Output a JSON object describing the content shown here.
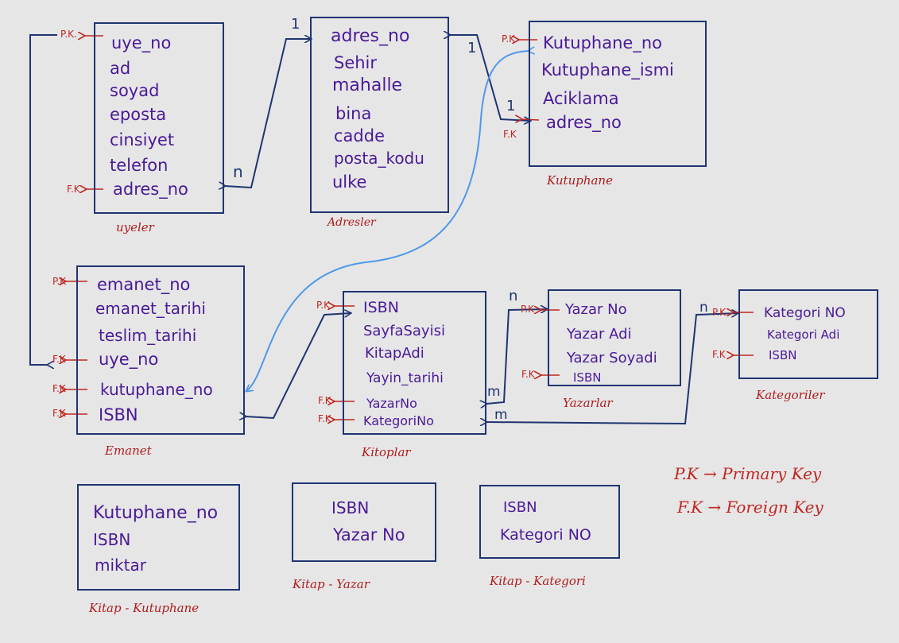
{
  "colors": {
    "background": "#e6e6e7",
    "box_border": "#1f3570",
    "field_text": "#4a1a96",
    "key_marker": "#c0261f",
    "caption": "#b01c1c",
    "blue_link": "#4f98e8"
  },
  "tables": {
    "uyeler": {
      "caption": "uyeler",
      "fields": [
        "uye_no",
        "ad",
        "soyad",
        "eposta",
        "cinsiyet",
        "telefon",
        "adres_no"
      ],
      "keys": [
        "P.K.",
        "F.K."
      ]
    },
    "adresler": {
      "caption": "Adresler",
      "fields": [
        "adres_no",
        "Sehir",
        "mahalle",
        "bina",
        "cadde",
        "posta_kodu",
        "ulke"
      ]
    },
    "kutuphane": {
      "caption": "Kutuphane",
      "fields": [
        "Kutuphane_no",
        "Kutuphane_ismi",
        "Aciklama",
        "adres_no"
      ],
      "keys": [
        "P.K",
        "F.K"
      ]
    },
    "emanet": {
      "caption": "Emanet",
      "fields": [
        "emanet_no",
        "emanet_tarihi",
        "teslim_tarihi",
        "uye_no",
        "kutuphane_no",
        "ISBN"
      ],
      "keys": [
        "P.K",
        "F.K",
        "F.K",
        "F.K"
      ]
    },
    "kitaplar": {
      "caption": "Kitoplar",
      "fields": [
        "ISBN",
        "SayfaSayisi",
        "KitapAdi",
        "Yayin_tarihi",
        "YazarNo",
        "KategoriNo"
      ],
      "keys": [
        "P.K",
        "F.K",
        "F.K"
      ]
    },
    "yazarlar": {
      "caption": "Yazarlar",
      "fields": [
        "Yazar No",
        "Yazar Adi",
        "Yazar Soyadi",
        "ISBN"
      ],
      "keys": [
        "P.K",
        "F.K"
      ]
    },
    "kategoriler": {
      "caption": "Kategoriler",
      "fields": [
        "Kategori NO",
        "Kategori Adi",
        "ISBN"
      ],
      "keys": [
        "P.K",
        "F.K"
      ]
    },
    "kitap_kutuphane": {
      "caption": "Kitap - Kutuphane",
      "fields": [
        "Kutuphane_no",
        "ISBN",
        "miktar"
      ]
    },
    "kitap_yazar": {
      "caption": "Kitap - Yazar",
      "fields": [
        "ISBN",
        "Yazar No"
      ]
    },
    "kitap_kategori": {
      "caption": "Kitap - Kategori",
      "fields": [
        "ISBN",
        "Kategori NO"
      ]
    }
  },
  "cardinalities": {
    "adres_uye_one": "1",
    "adres_uye_many": "n",
    "adres_kutuphane_one_a": "1",
    "adres_kutuphane_one_b": "1",
    "yazar_many": "n",
    "kitap_yazar_many": "m",
    "kategori_many": "n",
    "kitap_kategori_many": "m"
  },
  "legend": {
    "pk": "P.K → Primary Key",
    "fk": "F.K → Foreign Key"
  }
}
